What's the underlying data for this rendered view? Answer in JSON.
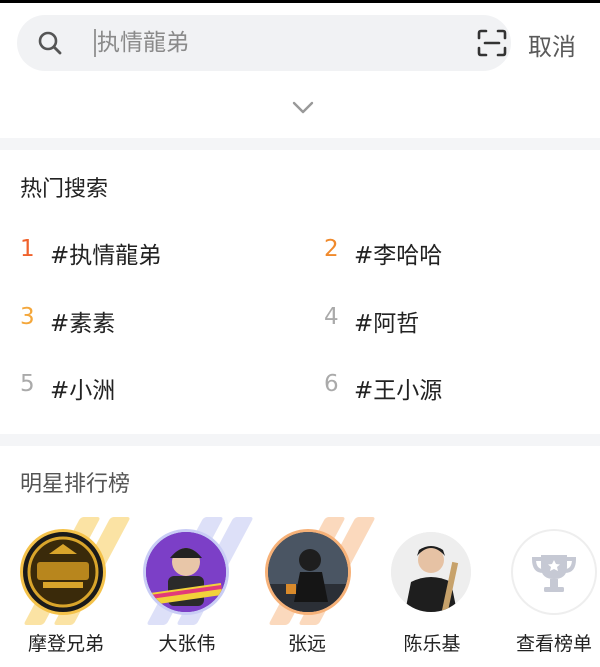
{
  "search": {
    "placeholder": "执情龍弟",
    "cancel_label": "取消"
  },
  "icons": {
    "search": "search-icon",
    "scan": "scan-icon",
    "expand": "chevron-down-icon",
    "trophy": "trophy-icon"
  },
  "hot_search": {
    "title": "热门搜索",
    "items": [
      {
        "rank": "1",
        "text": "#执情龍弟",
        "rank_color": "#f0622c"
      },
      {
        "rank": "2",
        "text": "#李哈哈",
        "rank_color": "#f08a2c"
      },
      {
        "rank": "3",
        "text": "#素素",
        "rank_color": "#f4a73b"
      },
      {
        "rank": "4",
        "text": "#阿哲",
        "rank_color": "#aaaaaa"
      },
      {
        "rank": "5",
        "text": "#小洲",
        "rank_color": "#aaaaaa"
      },
      {
        "rank": "6",
        "text": "#王小源",
        "rank_color": "#aaaaaa"
      }
    ]
  },
  "star_ranking": {
    "title": "明星排行榜",
    "stars": [
      {
        "name": "摩登兄弟"
      },
      {
        "name": "大张伟"
      },
      {
        "name": "张远"
      },
      {
        "name": "陈乐基"
      },
      {
        "name": "查看榜单"
      }
    ]
  },
  "colors": {
    "accent_gold": "#f4c24a",
    "accent_blue": "#c9cdf5",
    "accent_orange": "#f6b178"
  }
}
